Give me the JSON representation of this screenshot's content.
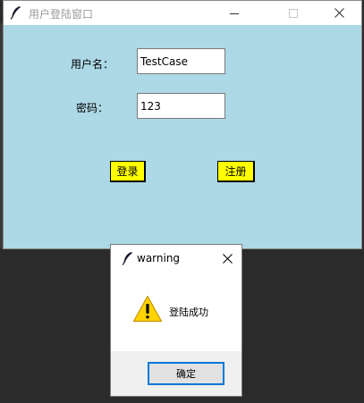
{
  "main_window": {
    "title": "用户登陆窗口",
    "background_color": "#add8e6",
    "icons": {
      "app": "feather-icon",
      "minimize": "minimize-icon",
      "maximize": "maximize-icon",
      "close": "close-icon"
    },
    "username": {
      "label": "用户名：",
      "value": "TestCase"
    },
    "password": {
      "label": "密码：",
      "value": "123"
    },
    "buttons": {
      "login": "登录",
      "register": "注册",
      "button_color": "#ffff00"
    }
  },
  "dialog": {
    "title": "warning",
    "message": "登陆成功",
    "ok_label": "确定",
    "icons": {
      "app": "feather-icon",
      "close": "close-icon",
      "warning": "warning-icon"
    },
    "ok_border_color": "#0078d7"
  }
}
